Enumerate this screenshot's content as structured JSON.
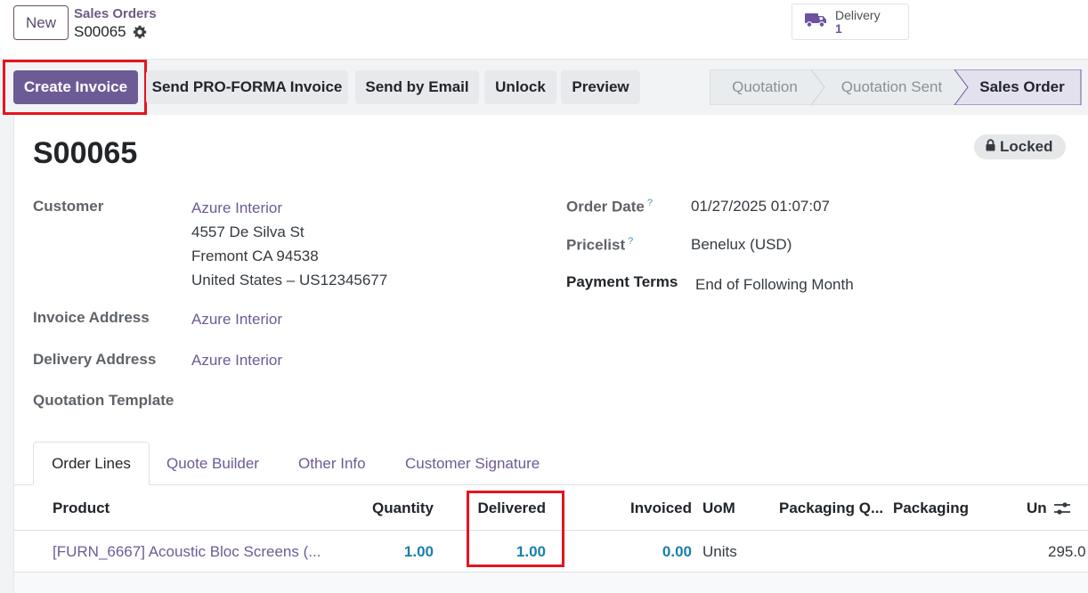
{
  "control_panel": {
    "new_label": "New",
    "breadcrumb_parent": "Sales Orders",
    "record_name": "S00065",
    "smart_button": {
      "label": "Delivery",
      "value": "1"
    }
  },
  "actions": {
    "create_invoice": "Create Invoice",
    "send_proforma": "Send PRO-FORMA Invoice",
    "send_email": "Send by Email",
    "unlock": "Unlock",
    "preview": "Preview"
  },
  "statusbar": {
    "stages": [
      "Quotation",
      "Quotation Sent",
      "Sales Order"
    ],
    "active": "Sales Order"
  },
  "form": {
    "title": "S00065",
    "locked_badge": "Locked",
    "customer": {
      "label": "Customer",
      "name": "Azure Interior",
      "address_line1": "4557 De Silva St",
      "address_line2": "Fremont CA 94538",
      "address_line3": "United States – US12345677"
    },
    "invoice_address": {
      "label": "Invoice Address",
      "value": "Azure Interior"
    },
    "delivery_address": {
      "label": "Delivery Address",
      "value": "Azure Interior"
    },
    "quotation_template": {
      "label": "Quotation Template",
      "value": ""
    },
    "order_date": {
      "label": "Order Date",
      "help": "?",
      "value": "01/27/2025 01:07:07"
    },
    "pricelist": {
      "label": "Pricelist",
      "help": "?",
      "value": "Benelux (USD)"
    },
    "payment_terms": {
      "label": "Payment Terms",
      "value": "End of Following Month"
    }
  },
  "tabs": [
    "Order Lines",
    "Quote Builder",
    "Other Info",
    "Customer Signature"
  ],
  "order_lines": {
    "columns": {
      "product": "Product",
      "quantity": "Quantity",
      "delivered": "Delivered",
      "invoiced": "Invoiced",
      "uom": "UoM",
      "packaging_qty": "Packaging Q...",
      "packaging": "Packaging",
      "unit_price": "Un"
    },
    "rows": [
      {
        "product": "[FURN_6667] Acoustic Bloc Screens (...",
        "quantity": "1.00",
        "delivered": "1.00",
        "invoiced": "0.00",
        "uom": "Units",
        "unit_price": "295.0"
      }
    ]
  },
  "colors": {
    "primary": "#6d5b96",
    "highlight": "#e5141f",
    "numeric": "#1a7fa8"
  }
}
